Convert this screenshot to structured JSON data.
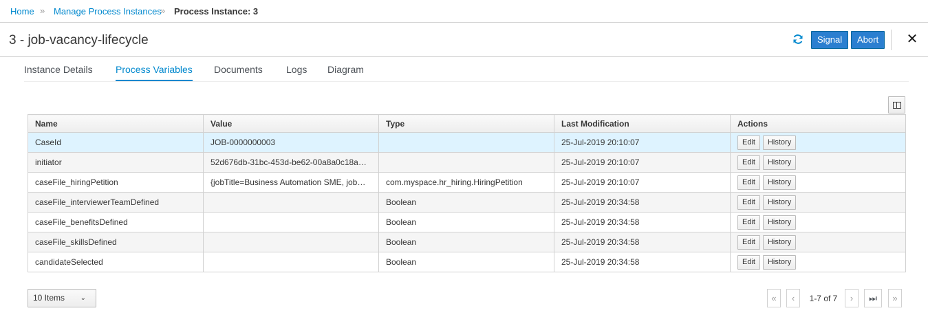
{
  "breadcrumb": {
    "home": "Home",
    "manage": "Manage Process Instances",
    "current": "Process Instance: 3",
    "separator": "»"
  },
  "header": {
    "title": "3 - job-vacancy-lifecycle",
    "signal_label": "Signal",
    "abort_label": "Abort",
    "close_glyph": "✕"
  },
  "tabs": [
    {
      "label": "Instance Details",
      "active": false
    },
    {
      "label": "Process Variables",
      "active": true
    },
    {
      "label": "Documents",
      "active": false
    },
    {
      "label": "Logs",
      "active": false
    },
    {
      "label": "Diagram",
      "active": false
    }
  ],
  "table": {
    "columns": [
      "Name",
      "Value",
      "Type",
      "Last Modification",
      "Actions"
    ],
    "edit_label": "Edit",
    "history_label": "History",
    "rows": [
      {
        "name": "CaseId",
        "value": "JOB-0000000003",
        "type": "",
        "modified": "25-Jul-2019 20:10:07"
      },
      {
        "name": "initiator",
        "value": "52d676db-31bc-453d-be62-00a8a0c18a…",
        "type": "",
        "modified": "25-Jul-2019 20:10:07"
      },
      {
        "name": "caseFile_hiringPetition",
        "value": "{jobTitle=Business Automation SME, job…",
        "type": "com.myspace.hr_hiring.HiringPetition",
        "modified": "25-Jul-2019 20:10:07"
      },
      {
        "name": "caseFile_interviewerTeamDefined",
        "value": "",
        "type": "Boolean",
        "modified": "25-Jul-2019 20:34:58"
      },
      {
        "name": "caseFile_benefitsDefined",
        "value": "",
        "type": "Boolean",
        "modified": "25-Jul-2019 20:34:58"
      },
      {
        "name": "caseFile_skillsDefined",
        "value": "",
        "type": "Boolean",
        "modified": "25-Jul-2019 20:34:58"
      },
      {
        "name": "candidateSelected",
        "value": "",
        "type": "Boolean",
        "modified": "25-Jul-2019 20:34:58"
      }
    ]
  },
  "pagination": {
    "page_size": "10 Items",
    "range": "1-7 of 7",
    "first_glyph": "«",
    "prev_glyph": "‹",
    "next_glyph": "›",
    "last_glyph": "⏭",
    "end_glyph": "»"
  },
  "colors": {
    "accent": "#0088ce",
    "primary_button": "#2b7fd0",
    "selected_row": "#def3ff"
  }
}
